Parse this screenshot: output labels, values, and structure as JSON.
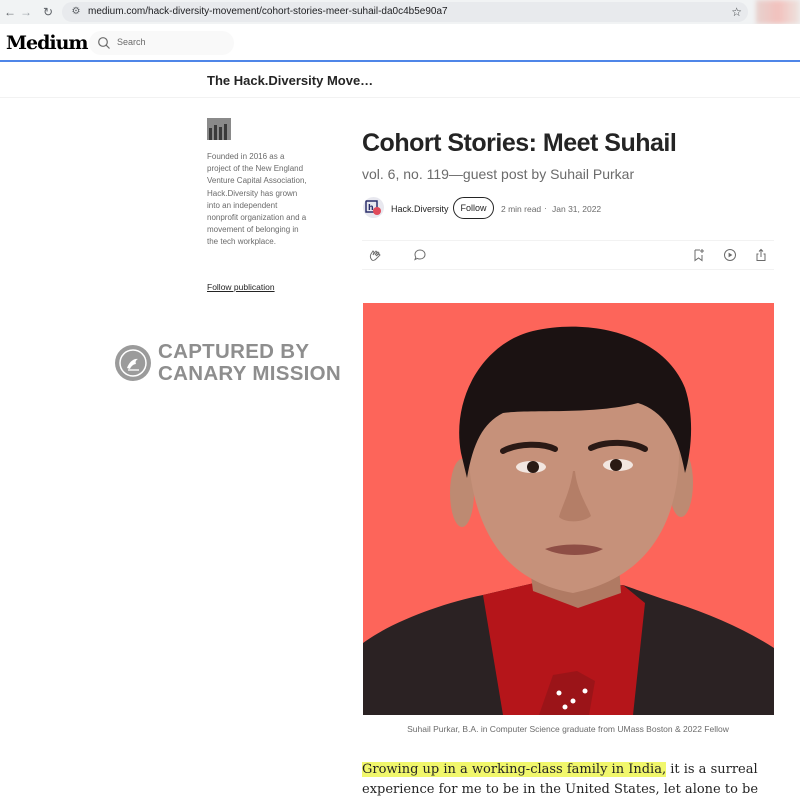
{
  "browser": {
    "back_icon": "arrow-left-icon",
    "forward_icon": "arrow-right-icon",
    "reload_icon": "reload-icon",
    "url": "medium.com/hack-diversity-movement/cohort-stories-meer-suhail-da0c4b5e90a7",
    "bookmark_icon": "star-icon"
  },
  "header": {
    "logo": "Medium",
    "search_placeholder": "Search"
  },
  "publication": {
    "name": "The Hack.Diversity Move…",
    "description": "Founded in 2016 as a project of the New England Venture Capital Association, Hack.Diversity has grown into an independent nonprofit organization and a movement of belonging in the tech workplace.",
    "follow_link": "Follow publication"
  },
  "watermark": {
    "line1": "CAPTURED BY",
    "line2": "CANARY MISSION"
  },
  "article": {
    "title": "Cohort Stories: Meet Suhail",
    "subtitle": "vol. 6, no. 119—guest post by Suhail Purkar",
    "author": "Hack.Diversity",
    "follow_label": "Follow",
    "read_time": "2 min read",
    "separator": "·",
    "date": "Jan 31, 2022",
    "actions": [
      "clap-icon",
      "comment-icon",
      "bookmark-add-icon",
      "play-icon",
      "share-icon"
    ],
    "image_caption": "Suhail Purkar, B.A. in Computer Science graduate from UMass Boston & 2022 Fellow",
    "body_highlight": "Growing up in a working-class family in India,",
    "body_rest": " it is a surreal experience for me to be in the United States, let alone to be pursuing a career as a software"
  },
  "colors": {
    "accent_line": "#4f86e8",
    "image_background": "#fd655a",
    "highlight": "#f1f76c"
  }
}
